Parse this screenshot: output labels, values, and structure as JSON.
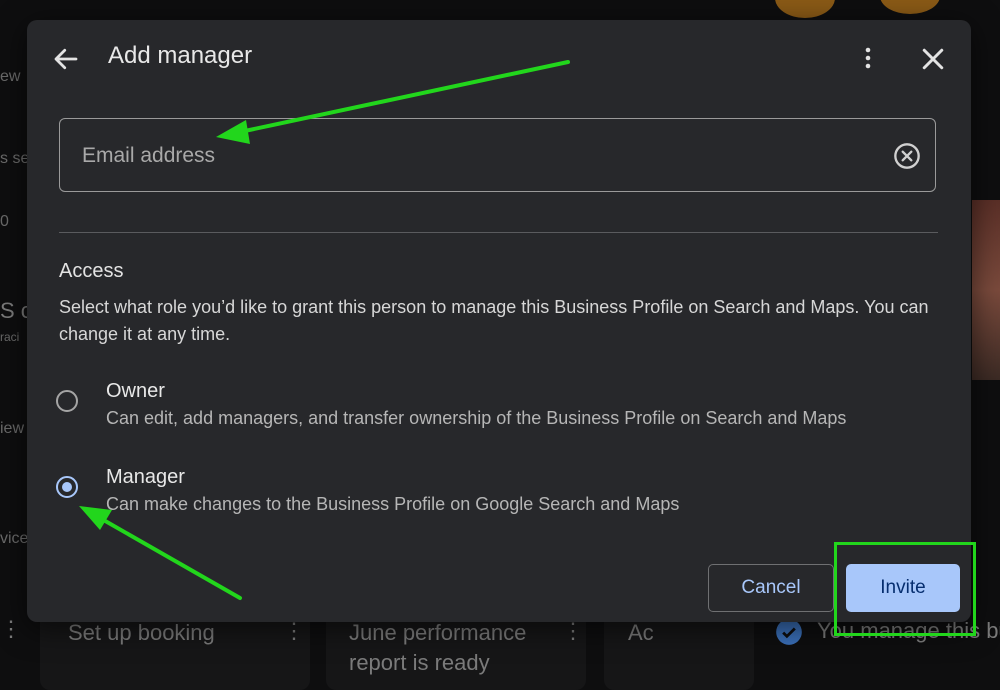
{
  "dialog": {
    "title": "Add manager",
    "email_placeholder": "Email address",
    "email_value": "",
    "access_heading": "Access",
    "access_description": "Select what role you’d like to grant this person to manage this Business Profile on Search and Maps. You can change it at any time.",
    "options": [
      {
        "label": "Owner",
        "description": "Can edit, add managers, and transfer ownership of the Business Profile on Search and Maps",
        "selected": false
      },
      {
        "label": "Manager",
        "description": "Can make changes to the Business Profile on Google Search and Maps",
        "selected": true
      }
    ],
    "cancel_label": "Cancel",
    "invite_label": "Invite"
  },
  "background": {
    "bottom_cards": [
      "Set up booking",
      "June performance",
      "report is ready",
      "Ac"
    ],
    "verified_text": "You manage this bus",
    "left_fragments": [
      "ew",
      "s se",
      "0",
      "S c",
      "raci",
      "iew",
      "vice"
    ]
  },
  "colors": {
    "dialog_bg": "#27282b",
    "accent": "#a8c7fa",
    "annotation": "#22d61c"
  },
  "icons": [
    "arrow-back-icon",
    "more-vert-icon",
    "close-icon",
    "clear-circle-icon",
    "verified-check-icon"
  ]
}
